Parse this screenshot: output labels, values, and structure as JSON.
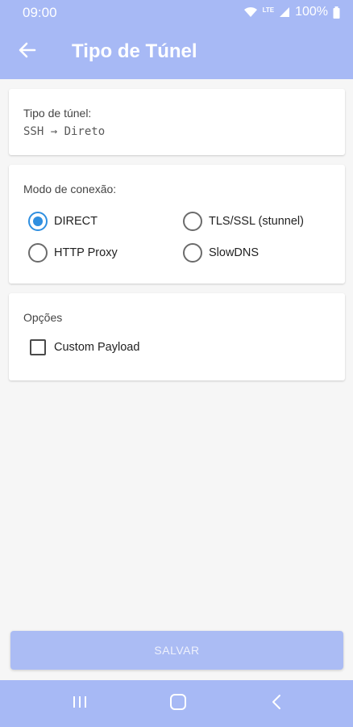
{
  "status_bar": {
    "time": "09:00",
    "network": "LTE",
    "battery": "100%"
  },
  "app_bar": {
    "title": "Tipo de Túnel",
    "back_icon": "arrow-left-icon"
  },
  "tunnel_card": {
    "label": "Tipo de túnel:",
    "value": "SSH → Direto"
  },
  "connection_mode": {
    "label": "Modo de conexão:",
    "options": [
      {
        "label": "DIRECT",
        "selected": true
      },
      {
        "label": "TLS/SSL (stunnel)",
        "selected": false
      },
      {
        "label": "HTTP Proxy",
        "selected": false
      },
      {
        "label": "SlowDNS",
        "selected": false
      }
    ]
  },
  "options_card": {
    "label": "Opções",
    "custom_payload_label": "Custom Payload",
    "custom_payload_checked": false
  },
  "save_button": {
    "label": "SALVAR"
  },
  "nav_bar": {
    "icons": [
      "recents-icon",
      "home-icon",
      "back-icon"
    ]
  },
  "colors": {
    "primary": "#a7b9f5",
    "accent": "#2f8fe0",
    "background": "#f6f6f6",
    "card": "#ffffff"
  }
}
